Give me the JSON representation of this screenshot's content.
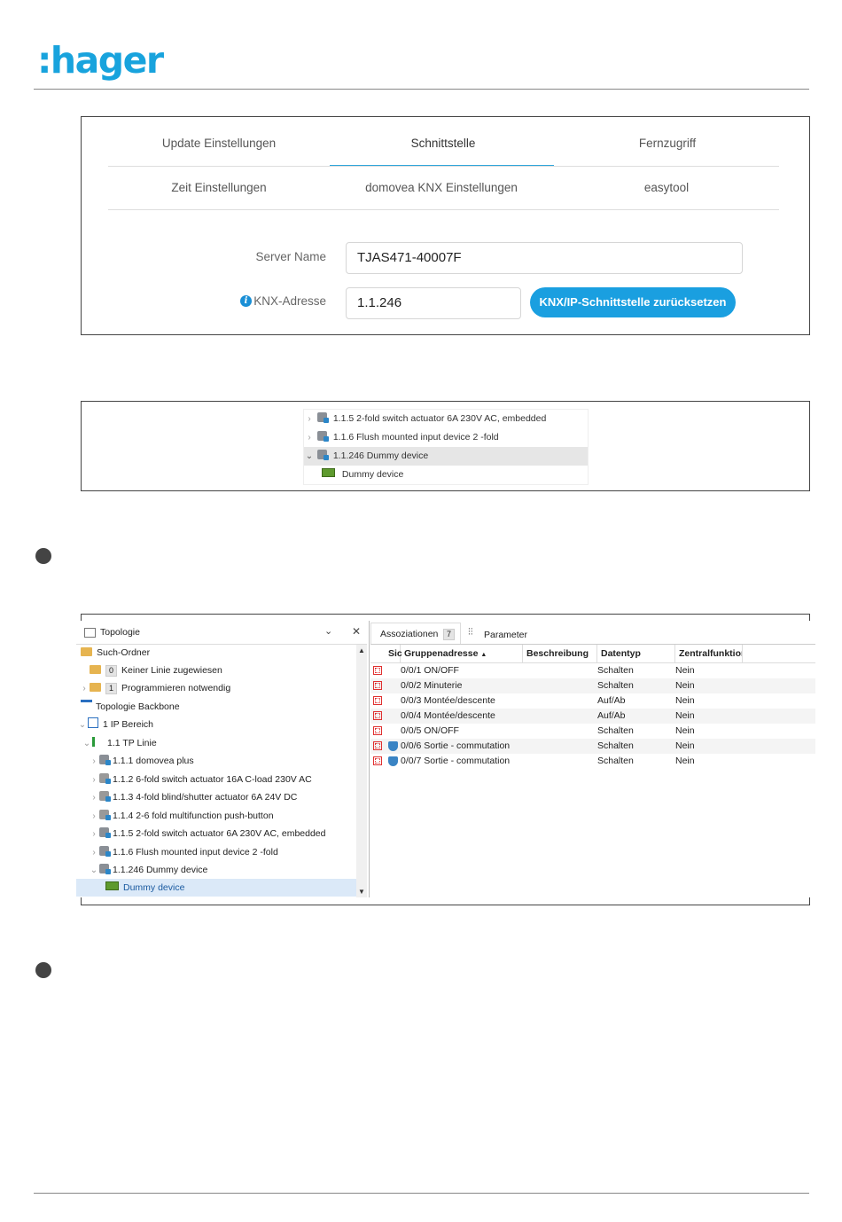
{
  "brand": {
    "logo": ":hager",
    "color": "#18a3dd"
  },
  "settings": {
    "tabs_row1": [
      "Update Einstellungen",
      "Schnittstelle",
      "Fernzugriff"
    ],
    "tabs_row2": [
      "Zeit Einstellungen",
      "domovea KNX Einstellungen",
      "easytool"
    ],
    "active_tab": "Schnittstelle",
    "server_name_label": "Server Name",
    "server_name_value": "TJAS471-40007F",
    "knx_label": "KNX-Adresse",
    "knx_value": "1.1.246",
    "reset_button": "KNX/IP-Schnittstelle zurücksetzen",
    "accent": "#1a9fe0"
  },
  "tree_small": {
    "items": [
      {
        "label": "1.1.5 2-fold switch actuator 6A 230V AC, embedded",
        "expanded": false
      },
      {
        "label": "1.1.6 Flush mounted input device 2 -fold",
        "expanded": false
      },
      {
        "label": "1.1.246 Dummy device",
        "expanded": true,
        "selected": true
      },
      {
        "label": "Dummy device",
        "child": true
      }
    ]
  },
  "ets": {
    "left": {
      "title": "Topologie",
      "rows": [
        {
          "label": "Such-Ordner",
          "type": "folder",
          "level": 0,
          "bold": false
        },
        {
          "label": "Keiner Linie zugewiesen",
          "badge": "0",
          "type": "folder",
          "level": 1
        },
        {
          "label": "Programmieren notwendig",
          "badge": "1",
          "type": "folder",
          "level": 1
        },
        {
          "label": "Topologie Backbone",
          "type": "backbone",
          "level": 0
        },
        {
          "label": "1 IP Bereich",
          "type": "area",
          "level": 0
        },
        {
          "label": "1.1 TP Linie",
          "type": "line",
          "level": 1
        },
        {
          "label": "1.1.1 domovea plus",
          "type": "device",
          "level": 2
        },
        {
          "label": "1.1.2 6-fold switch actuator 16A C-load 230V AC",
          "type": "device",
          "level": 2
        },
        {
          "label": "1.1.3 4-fold blind/shutter actuator 6A 24V DC",
          "type": "device",
          "level": 2
        },
        {
          "label": "1.1.4 2-6 fold multifunction push-button",
          "type": "device",
          "level": 2
        },
        {
          "label": "1.1.5 2-fold switch actuator 6A 230V AC, embedded",
          "type": "device",
          "level": 2
        },
        {
          "label": "1.1.6 Flush mounted input device 2 -fold",
          "type": "device",
          "level": 2
        },
        {
          "label": "1.1.246 Dummy device",
          "type": "device",
          "level": 2
        },
        {
          "label": "Dummy device",
          "type": "child",
          "level": 3
        }
      ]
    },
    "right": {
      "tab_assoc": "Assoziationen",
      "tab_assoc_count": "7",
      "tab_param": "Parameter",
      "columns": [
        "Sic",
        "Gruppenadresse",
        "Beschreibung",
        "Datentyp",
        "Zentralfunktior"
      ],
      "rows": [
        {
          "ga": "0/0/1 ON/OFF",
          "type": "Schalten",
          "central": "Nein",
          "shield": false
        },
        {
          "ga": "0/0/2 Minuterie",
          "type": "Schalten",
          "central": "Nein",
          "shield": false
        },
        {
          "ga": "0/0/3 Montée/descente",
          "type": "Auf/Ab",
          "central": "Nein",
          "shield": false
        },
        {
          "ga": "0/0/4 Montée/descente",
          "type": "Auf/Ab",
          "central": "Nein",
          "shield": false
        },
        {
          "ga": "0/0/5 ON/OFF",
          "type": "Schalten",
          "central": "Nein",
          "shield": false
        },
        {
          "ga": "0/0/6 Sortie - commutation",
          "type": "Schalten",
          "central": "Nein",
          "shield": true
        },
        {
          "ga": "0/0/7 Sortie - commutation",
          "type": "Schalten",
          "central": "Nein",
          "shield": true
        }
      ]
    }
  }
}
